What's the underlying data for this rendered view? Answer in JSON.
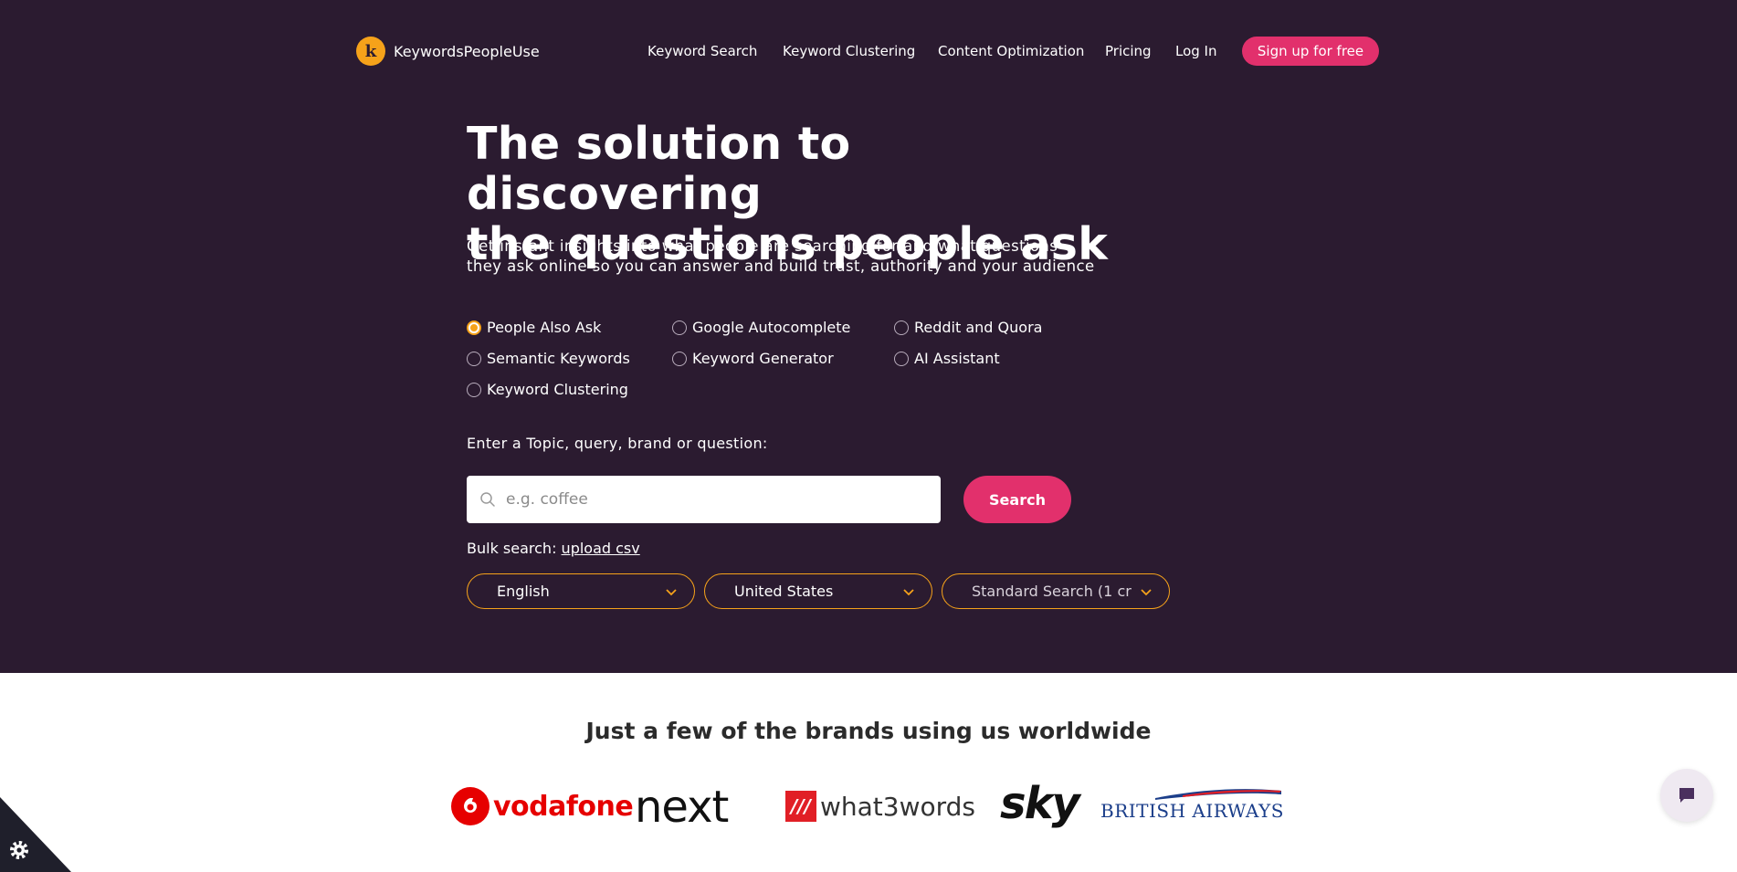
{
  "header": {
    "logo_text": "KeywordsPeopleUse",
    "nav": [
      "Keyword Search",
      "Keyword Clustering",
      "Content Optimization",
      "Pricing",
      "Log In"
    ],
    "signup_label": "Sign up for free"
  },
  "hero": {
    "headline_line1": "The solution to discovering",
    "headline_line2": "the questions people ask",
    "subhead_line1": "Get instant insights into what people are searching for and what questions",
    "subhead_line2": "they ask online so you can answer and build trust, authority and your audience"
  },
  "search_modes": [
    {
      "label": "People Also Ask",
      "checked": true
    },
    {
      "label": "Google Autocomplete",
      "checked": false
    },
    {
      "label": "Reddit and Quora",
      "checked": false
    },
    {
      "label": "Semantic Keywords",
      "checked": false
    },
    {
      "label": "Keyword Generator",
      "checked": false
    },
    {
      "label": "AI Assistant",
      "checked": false
    },
    {
      "label": "Keyword Clustering",
      "checked": false
    }
  ],
  "search": {
    "prompt": "Enter a Topic, query, brand or question:",
    "placeholder": "e.g. coffee",
    "value": "",
    "button_label": "Search",
    "bulk_label": "Bulk search:",
    "bulk_link": "upload csv"
  },
  "selects": {
    "language": "English",
    "country": "United States",
    "search_type": "Standard Search (1 cre"
  },
  "brands": {
    "title": "Just a few of the brands using us worldwide",
    "vodafone": "vodafone",
    "next": "next",
    "what3words": "what3words",
    "w3w_mark": "///",
    "sky": "sky",
    "british_airways": "BRITISH AIRWAYS"
  },
  "colors": {
    "hero_bg": "#2b1b30",
    "accent_pink": "#e2306c",
    "accent_orange": "#f6a21a"
  }
}
